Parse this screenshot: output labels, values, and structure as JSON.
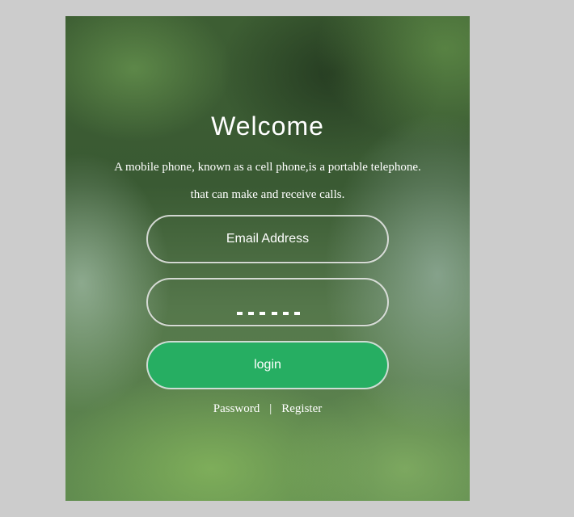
{
  "login_form": {
    "title": "Welcome",
    "description_line1": "A mobile phone, known as a cell phone,is a portable telephone.",
    "description_line2": "that can make and receive calls.",
    "email_placeholder": "Email Address",
    "password_value": "••••••",
    "login_button_label": "login",
    "password_link": "Password",
    "separator": "|",
    "register_link": "Register"
  },
  "colors": {
    "page_background": "#cccccc",
    "login_button": "#26ae62",
    "text": "#ffffff"
  }
}
